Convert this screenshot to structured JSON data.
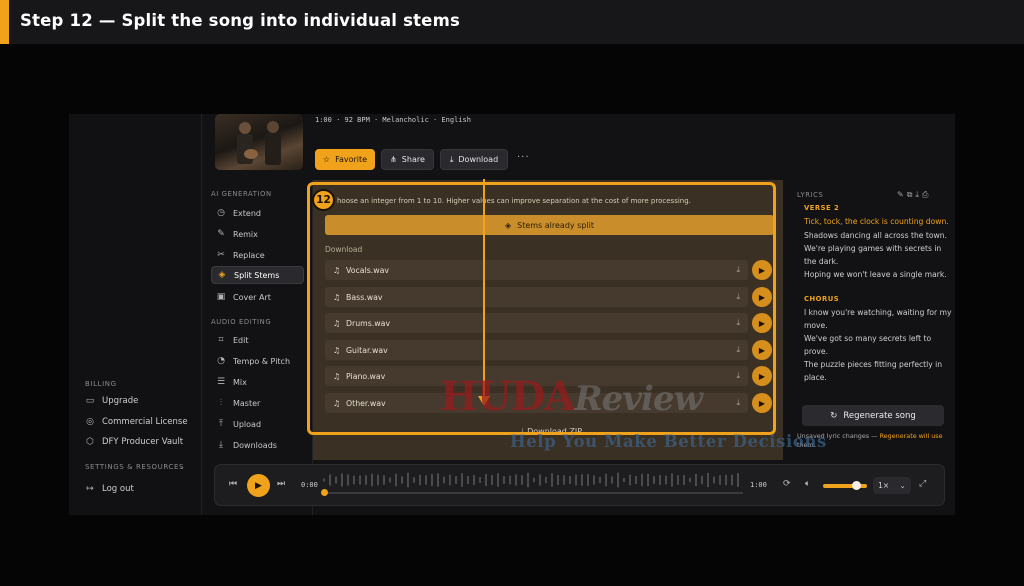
{
  "banner": {
    "title": "Step 12 — Split the song into individual stems"
  },
  "header": {
    "meta": "1:00 · 92 BPM · Melancholic · English",
    "buttons": {
      "favorite": "Favorite",
      "share": "Share",
      "download": "Download",
      "more": "···"
    }
  },
  "left_sidebar": {
    "billing_label": "BILLING",
    "items": [
      "Upgrade",
      "Commercial License",
      "DFY Producer Vault"
    ],
    "settings_label": "SETTINGS & RESOURCES",
    "logout": "Log out"
  },
  "nav": {
    "ai_generation_label": "AI GENERATION",
    "ai_items": [
      "Extend",
      "Remix",
      "Replace",
      "Split Stems",
      "Cover Art"
    ],
    "audio_editing_label": "AUDIO EDITING",
    "audio_items": [
      "Edit",
      "Tempo & Pitch",
      "Mix",
      "Master",
      "Upload",
      "Downloads"
    ],
    "active": "Split Stems"
  },
  "stems": {
    "hint": "hoose an integer from 1 to 10. Higher values can improve separation at the cost of more processing.",
    "status_button": "Stems already split",
    "download_label": "Download",
    "files": [
      "Vocals.wav",
      "Bass.wav",
      "Drums.wav",
      "Guitar.wav",
      "Piano.wav",
      "Other.wav"
    ],
    "zip": "Download ZIP"
  },
  "annotation": {
    "step_number": "12",
    "color": "#f0a21b"
  },
  "lyrics": {
    "title": "LYRICS",
    "verse_label": "VERSE 2",
    "verse_lines": [
      "Tick, tock, the clock is counting down.",
      "Shadows dancing all across the town.",
      "We're playing games with secrets in",
      "the dark.",
      "Hoping we won't leave a single mark."
    ],
    "chorus_label": "CHORUS",
    "chorus_lines": [
      "I know you're watching, waiting for my",
      "move.",
      "We've got so many secrets left to",
      "prove.",
      "The puzzle pieces fitting perfectly in",
      "place."
    ],
    "regenerate": "Regenerate song",
    "unsaved_prefix": "Unsaved lyric changes — ",
    "unsaved_link": "Regenerate will use",
    "unsaved_suffix": "them."
  },
  "player": {
    "current_time": "0:00",
    "duration": "1:00",
    "speed": "1×",
    "progress": 0.0,
    "volume": 0.75
  },
  "watermark": {
    "brand_main": "HUDA",
    "brand_tail": "Review",
    "tagline": "Help You Make Better Decisions"
  }
}
